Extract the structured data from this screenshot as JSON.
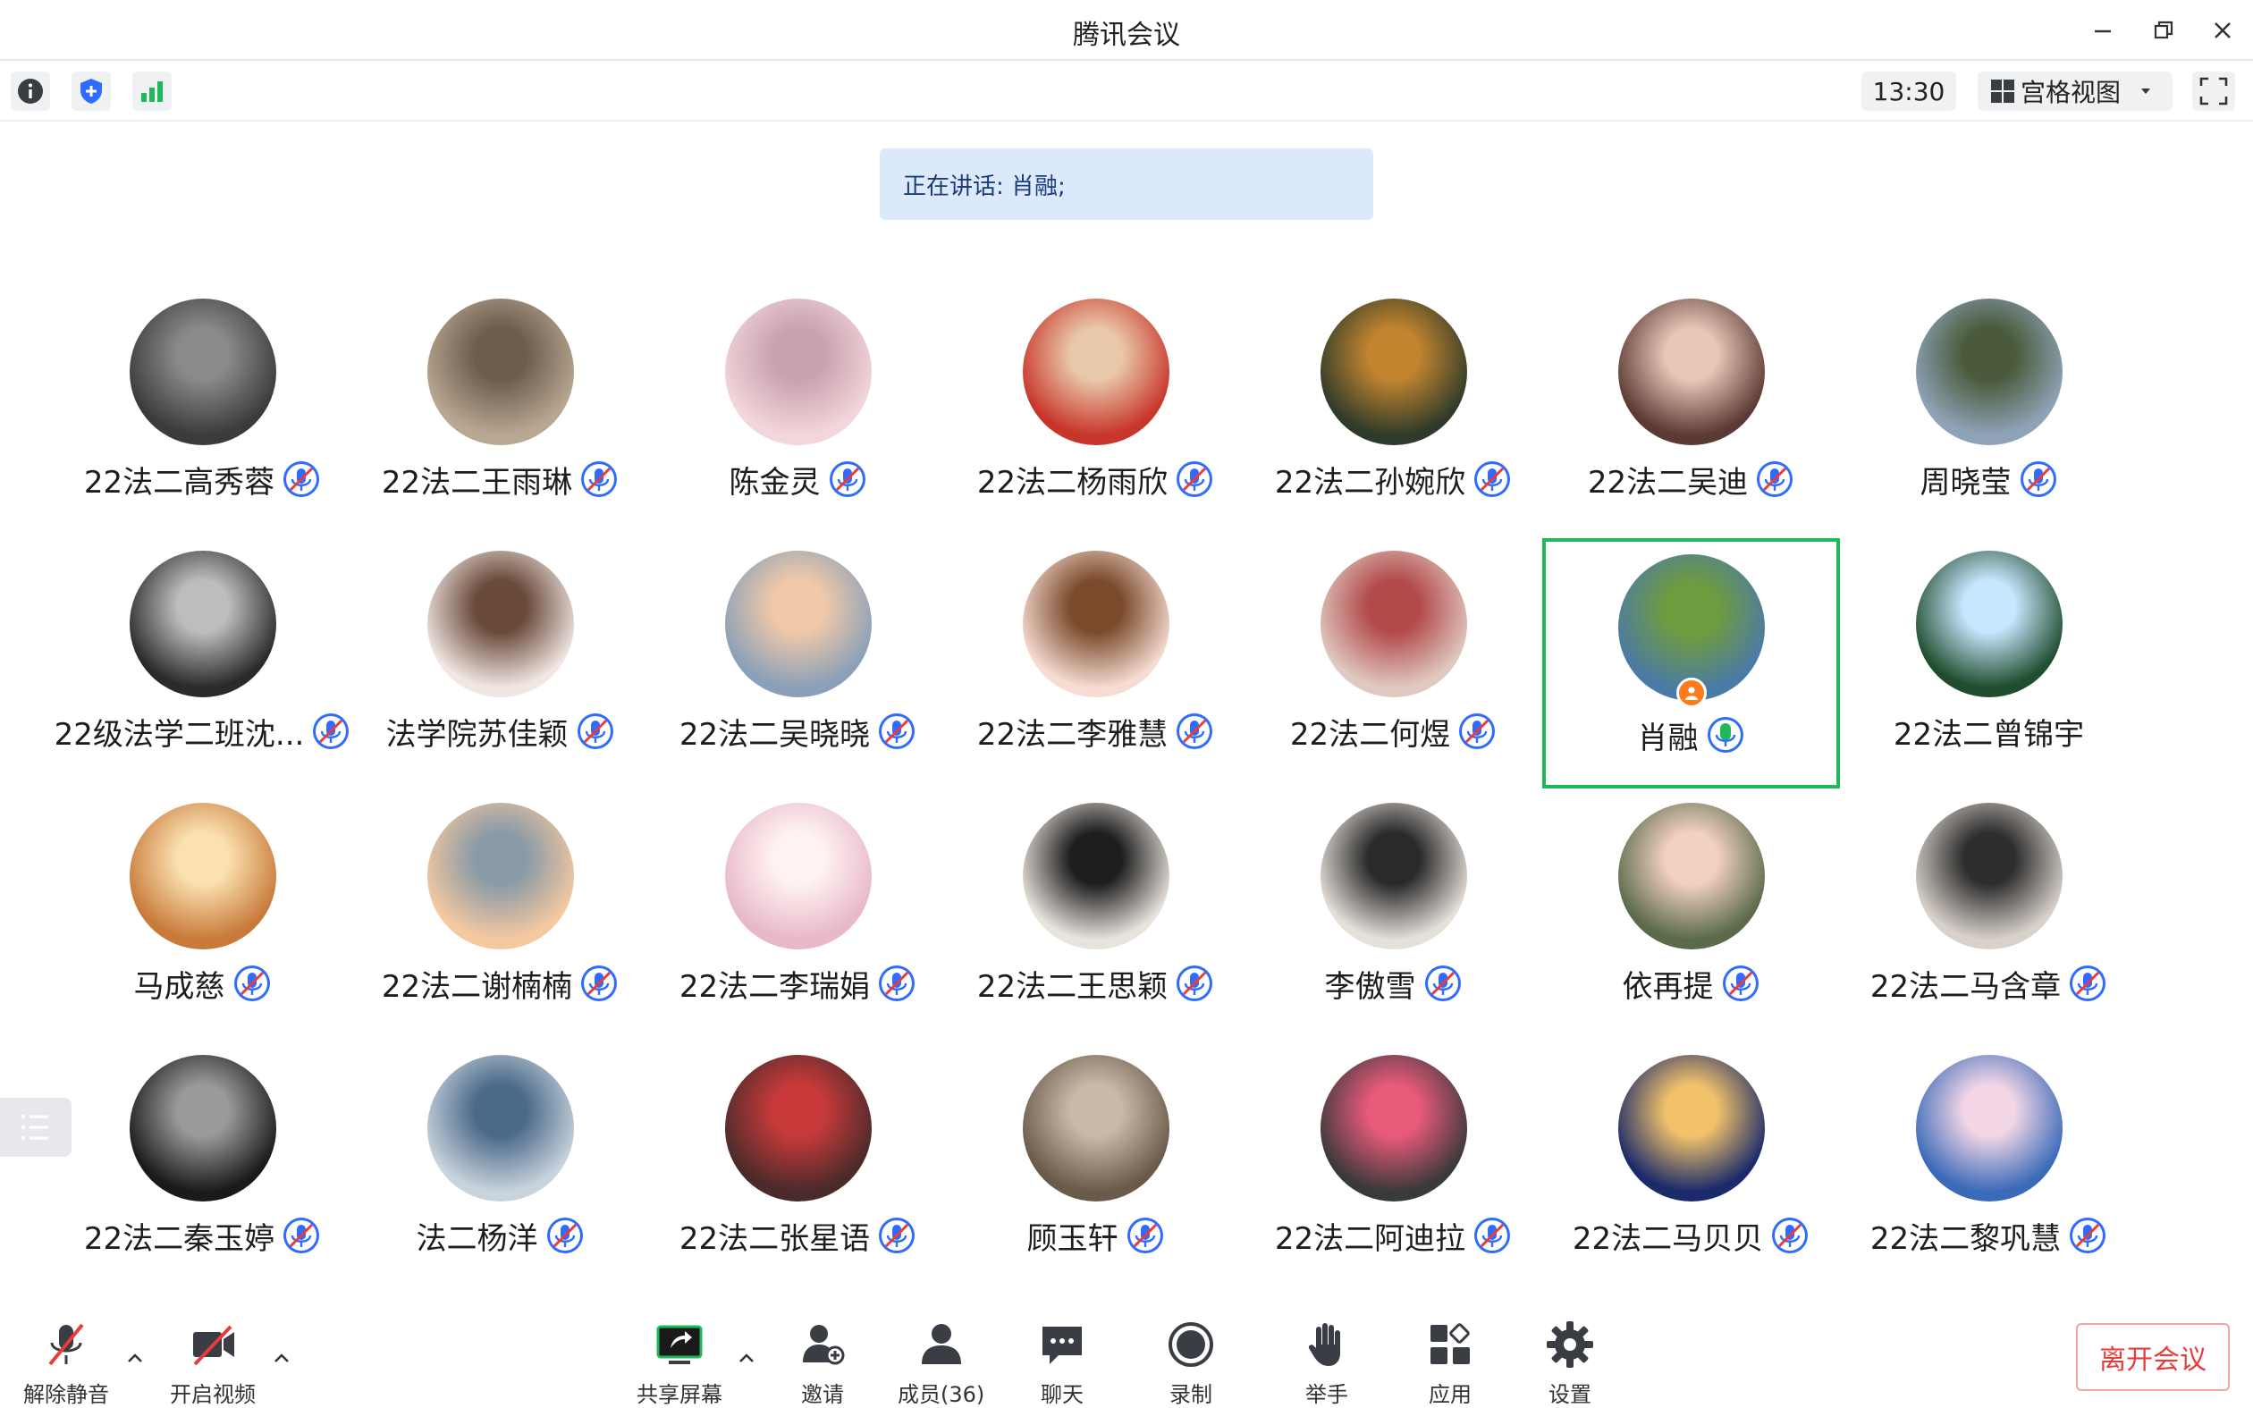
{
  "window": {
    "title": "腾讯会议"
  },
  "infobar": {
    "time": "13:30",
    "view_label": "宫格视图"
  },
  "speaking": {
    "text": "正在讲话: 肖融;"
  },
  "participants": [
    {
      "name": "22法二高秀蓉",
      "mic": "muted"
    },
    {
      "name": "22法二王雨琳",
      "mic": "muted"
    },
    {
      "name": "陈金灵",
      "mic": "muted"
    },
    {
      "name": "22法二杨雨欣",
      "mic": "muted"
    },
    {
      "name": "22法二孙婉欣",
      "mic": "muted"
    },
    {
      "name": "22法二吴迪",
      "mic": "muted"
    },
    {
      "name": "周晓莹",
      "mic": "muted"
    },
    {
      "name": "22级法学二班沈...",
      "mic": "muted"
    },
    {
      "name": "法学院苏佳颖",
      "mic": "muted"
    },
    {
      "name": "22法二吴晓晓",
      "mic": "muted"
    },
    {
      "name": "22法二李雅慧",
      "mic": "muted"
    },
    {
      "name": "22法二何煜",
      "mic": "muted"
    },
    {
      "name": "肖融",
      "mic": "speaking",
      "host": true
    },
    {
      "name": "22法二曾锦宇",
      "mic": "none"
    },
    {
      "name": "马成慈",
      "mic": "muted"
    },
    {
      "name": "22法二谢楠楠",
      "mic": "muted"
    },
    {
      "name": "22法二李瑞娟",
      "mic": "muted"
    },
    {
      "name": "22法二王思颖",
      "mic": "muted"
    },
    {
      "name": "李傲雪",
      "mic": "muted"
    },
    {
      "name": "依再提",
      "mic": "muted"
    },
    {
      "name": "22法二马含章",
      "mic": "muted"
    },
    {
      "name": "22法二秦玉婷",
      "mic": "muted"
    },
    {
      "name": "法二杨洋",
      "mic": "muted"
    },
    {
      "name": "22法二张星语",
      "mic": "muted"
    },
    {
      "name": "顾玉轩",
      "mic": "muted"
    },
    {
      "name": "22法二阿迪拉",
      "mic": "muted"
    },
    {
      "name": "22法二马贝贝",
      "mic": "muted"
    },
    {
      "name": "22法二黎巩慧",
      "mic": "muted"
    }
  ],
  "toolbar": {
    "unmute": "解除静音",
    "start_video": "开启视频",
    "share_screen": "共享屏幕",
    "invite": "邀请",
    "members": "成员(36)",
    "chat": "聊天",
    "record": "录制",
    "raise_hand": "举手",
    "apps": "应用",
    "settings": "设置",
    "leave": "离开会议"
  },
  "colors": {
    "accent_blue": "#2f6bff",
    "active_green": "#1fb85a",
    "leave_red": "#e83b3b",
    "banner_bg": "#dce9fb"
  }
}
